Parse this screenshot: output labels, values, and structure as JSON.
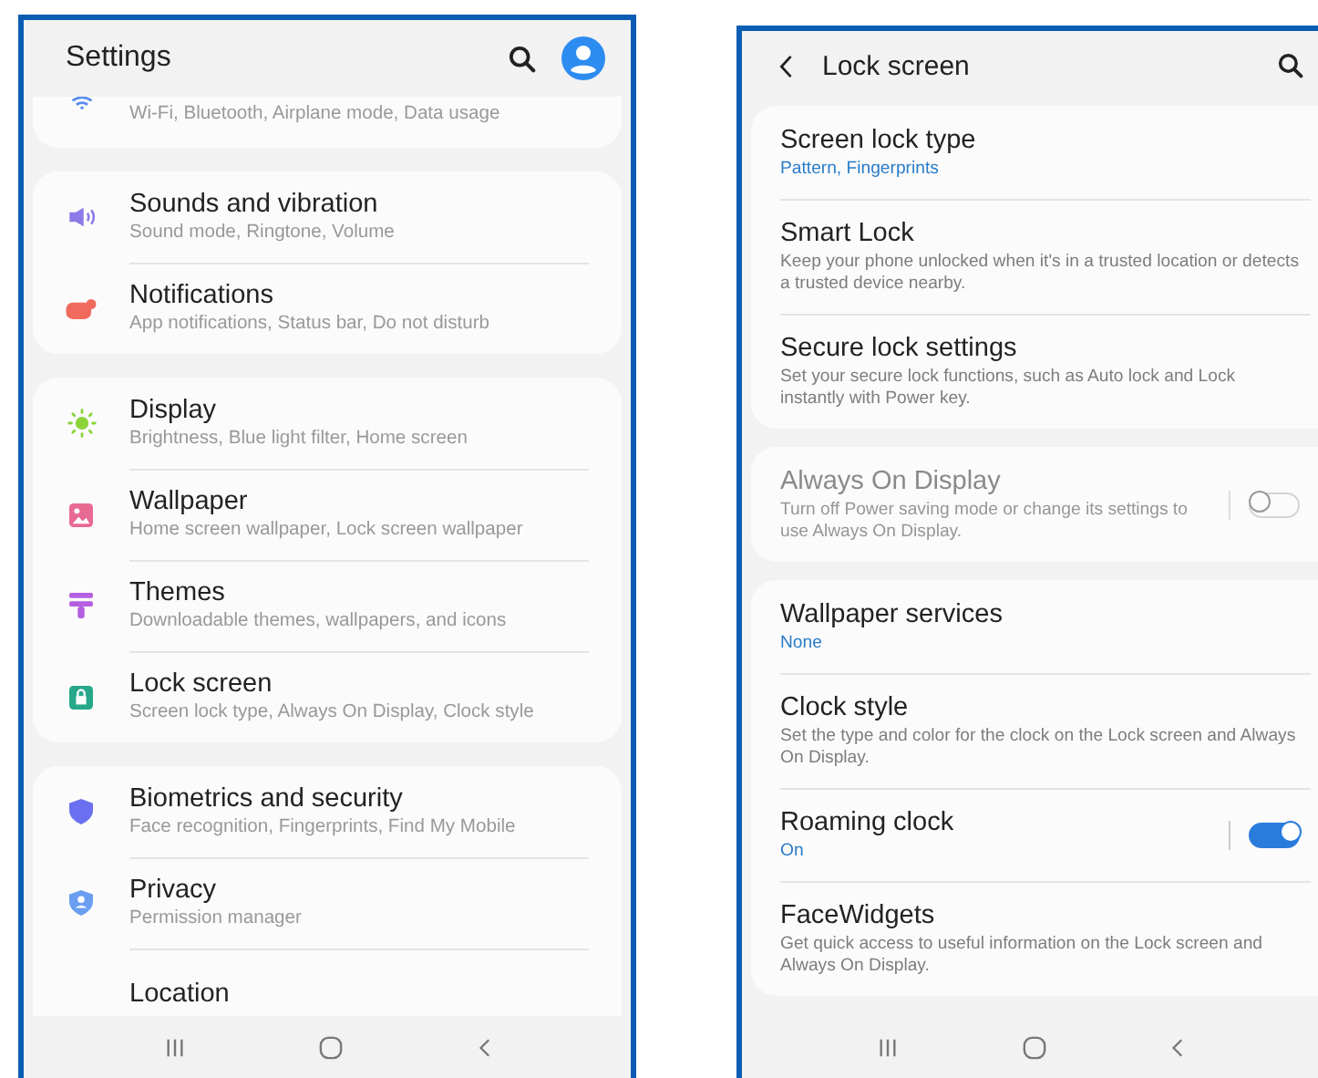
{
  "settings_screen": {
    "title": "Settings",
    "groups": [
      [
        {
          "subtitle": "Wi-Fi, Bluetooth, Airplane mode, Data usage"
        }
      ],
      [
        {
          "title": "Sounds and vibration",
          "subtitle": "Sound mode, Ringtone, Volume"
        },
        {
          "title": "Notifications",
          "subtitle": "App notifications, Status bar, Do not disturb"
        }
      ],
      [
        {
          "title": "Display",
          "subtitle": "Brightness, Blue light filter, Home screen"
        },
        {
          "title": "Wallpaper",
          "subtitle": "Home screen wallpaper, Lock screen wallpaper"
        },
        {
          "title": "Themes",
          "subtitle": "Downloadable themes, wallpapers, and icons"
        },
        {
          "title": "Lock screen",
          "subtitle": "Screen lock type, Always On Display, Clock style"
        }
      ],
      [
        {
          "title": "Biometrics and security",
          "subtitle": "Face recognition, Fingerprints, Find My Mobile"
        },
        {
          "title": "Privacy",
          "subtitle": "Permission manager"
        },
        {
          "title": "Location"
        }
      ]
    ]
  },
  "lock_screen": {
    "title": "Lock screen",
    "groups": [
      [
        {
          "kind": "plain",
          "title": "Screen lock type",
          "subtitle": "Pattern, Fingerprints",
          "accent": true,
          "disabled": false
        },
        {
          "kind": "plain",
          "title": "Smart Lock",
          "subtitle": "Keep your phone unlocked when it's in a trusted location or detects a trusted device nearby.",
          "accent": false,
          "disabled": false
        },
        {
          "kind": "plain",
          "title": "Secure lock settings",
          "subtitle": "Set your secure lock functions, such as Auto lock and Lock instantly with Power key.",
          "accent": false,
          "disabled": false
        }
      ],
      [
        {
          "kind": "toggle",
          "title": "Always On Display",
          "subtitle": "Turn off Power saving mode or change its settings to use Always On Display.",
          "accent": false,
          "disabled": true,
          "on": false
        }
      ],
      [
        {
          "kind": "plain",
          "title": "Wallpaper services",
          "subtitle": "None",
          "accent": true,
          "disabled": false
        },
        {
          "kind": "plain",
          "title": "Clock style",
          "subtitle": "Set the type and color for the clock on the Lock screen and Always On Display.",
          "accent": false,
          "disabled": false
        },
        {
          "kind": "toggle",
          "title": "Roaming clock",
          "subtitle": "On",
          "accent": true,
          "disabled": false,
          "on": true
        },
        {
          "kind": "plain",
          "title": "FaceWidgets",
          "subtitle": "Get quick access to useful information on the Lock screen and Always On Display.",
          "accent": false,
          "disabled": false
        }
      ]
    ]
  }
}
